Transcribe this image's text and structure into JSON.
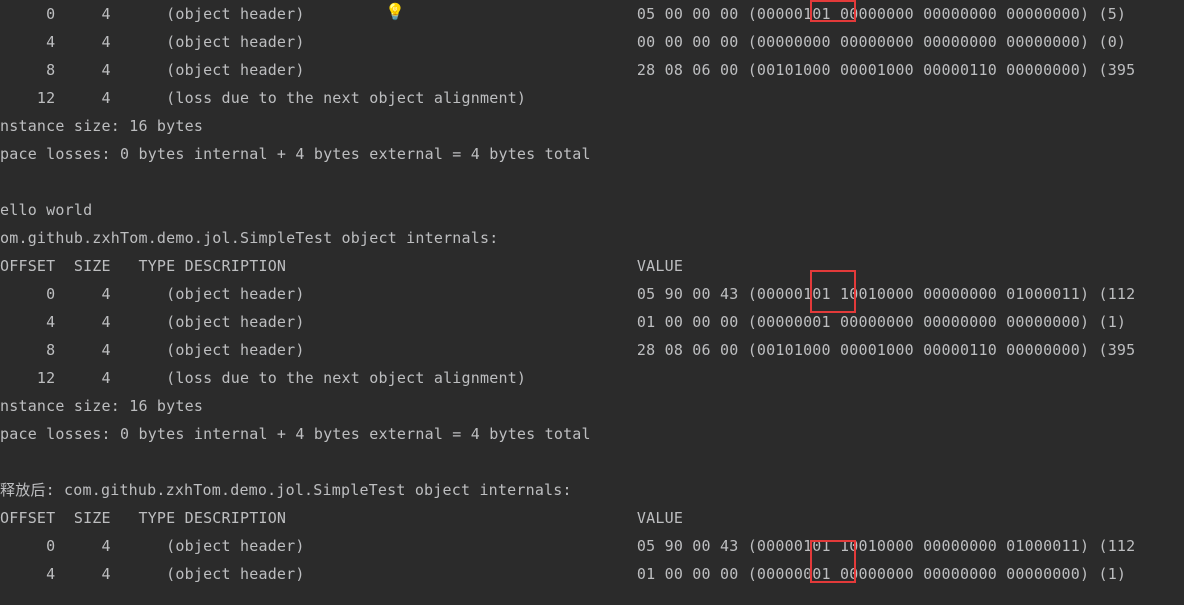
{
  "blocks": [
    {
      "header_lines": [],
      "rows": [
        {
          "offset": "0",
          "size": "4",
          "desc": "(object header)",
          "bulb": true,
          "value": "05 00 00 00 (00000101 00000000 00000000 00000000) (5)"
        },
        {
          "offset": "4",
          "size": "4",
          "desc": "(object header)",
          "bulb": false,
          "value": "00 00 00 00 (00000000 00000000 00000000 00000000) (0)"
        },
        {
          "offset": "8",
          "size": "4",
          "desc": "(object header)",
          "bulb": false,
          "value": "28 08 06 00 (00101000 00001000 00000110 00000000) (395"
        },
        {
          "offset": "12",
          "size": "4",
          "desc": "(loss due to the next object alignment)",
          "bulb": false,
          "value": ""
        }
      ],
      "footer_lines": [
        "nstance size: 16 bytes",
        "pace losses: 0 bytes internal + 4 bytes external = 4 bytes total",
        ""
      ]
    },
    {
      "header_lines": [
        "ello world",
        "om.github.zxhTom.demo.jol.SimpleTest object internals:"
      ],
      "column_header": {
        "left": "OFFSET  SIZE   TYPE DESCRIPTION",
        "right": "VALUE"
      },
      "rows": [
        {
          "offset": "0",
          "size": "4",
          "desc": "(object header)",
          "bulb": false,
          "value": "05 90 00 43 (00000101 10010000 00000000 01000011) (112"
        },
        {
          "offset": "4",
          "size": "4",
          "desc": "(object header)",
          "bulb": false,
          "value": "01 00 00 00 (00000001 00000000 00000000 00000000) (1)"
        },
        {
          "offset": "8",
          "size": "4",
          "desc": "(object header)",
          "bulb": false,
          "value": "28 08 06 00 (00101000 00001000 00000110 00000000) (395"
        },
        {
          "offset": "12",
          "size": "4",
          "desc": "(loss due to the next object alignment)",
          "bulb": false,
          "value": ""
        }
      ],
      "footer_lines": [
        "nstance size: 16 bytes",
        "pace losses: 0 bytes internal + 4 bytes external = 4 bytes total",
        ""
      ]
    },
    {
      "header_lines": [
        "释放后: com.github.zxhTom.demo.jol.SimpleTest object internals:"
      ],
      "column_header": {
        "left": "OFFSET  SIZE   TYPE DESCRIPTION",
        "right": "VALUE"
      },
      "rows": [
        {
          "offset": "0",
          "size": "4",
          "desc": "(object header)",
          "bulb": false,
          "value": "05 90 00 43 (00000101 10010000 00000000 01000011) (112"
        },
        {
          "offset": "4",
          "size": "4",
          "desc": "(object header)",
          "bulb": false,
          "value": "01 00 00 00 (00000001 00000000 00000000 00000000) (1)"
        }
      ],
      "footer_lines": []
    }
  ],
  "icons": {
    "bulb": "💡"
  },
  "colors": {
    "bg": "#2b2b2b",
    "fg": "#bdbec0",
    "highlight": "#e33a3a"
  }
}
